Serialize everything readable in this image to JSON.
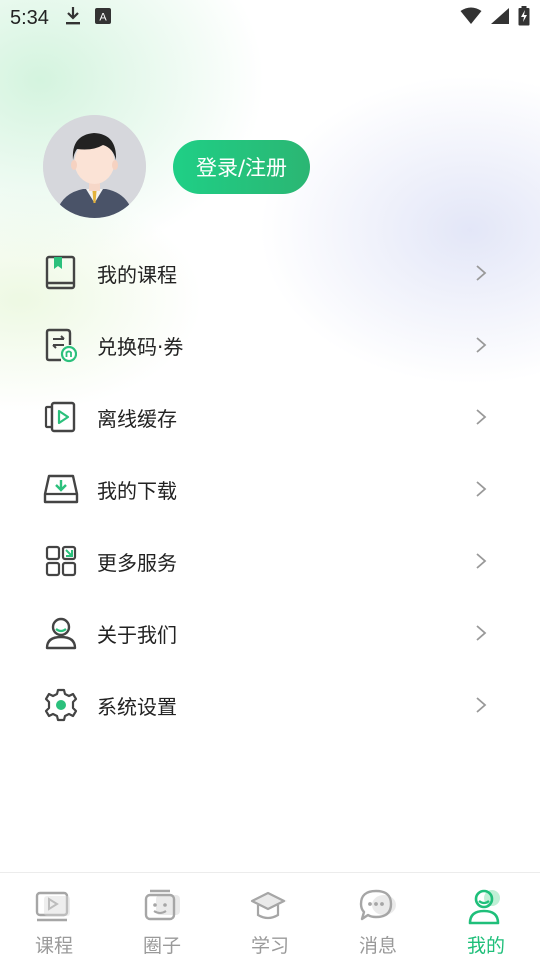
{
  "status_bar": {
    "time": "5:34",
    "left_icons": [
      "download-icon",
      "font-notification-icon"
    ],
    "right_icons": [
      "wifi-icon",
      "signal-icon",
      "battery-charging-icon"
    ]
  },
  "profile": {
    "avatar_icon": "default-avatar",
    "login_label": "登录/注册"
  },
  "menu": {
    "items": [
      {
        "label": "我的课程",
        "icon": "book-icon"
      },
      {
        "label": "兑换码·券",
        "icon": "coupon-icon"
      },
      {
        "label": "离线缓存",
        "icon": "offline-video-icon"
      },
      {
        "label": "我的下载",
        "icon": "download-tray-icon"
      },
      {
        "label": "更多服务",
        "icon": "grid-icon"
      },
      {
        "label": "关于我们",
        "icon": "user-icon"
      },
      {
        "label": "系统设置",
        "icon": "gear-icon"
      }
    ]
  },
  "bottom_nav": {
    "items": [
      {
        "label": "课程",
        "icon": "video-icon"
      },
      {
        "label": "圈子",
        "icon": "chat-face-icon"
      },
      {
        "label": "学习",
        "icon": "graduation-cap-icon"
      },
      {
        "label": "消息",
        "icon": "message-icon"
      },
      {
        "label": "我的",
        "icon": "person-icon",
        "active": true
      }
    ]
  },
  "colors": {
    "accent": "#1fbf7a",
    "login_gradient_start": "#1fcf86",
    "login_gradient_end": "#2bb673",
    "inactive_nav": "#9a9a9a"
  }
}
